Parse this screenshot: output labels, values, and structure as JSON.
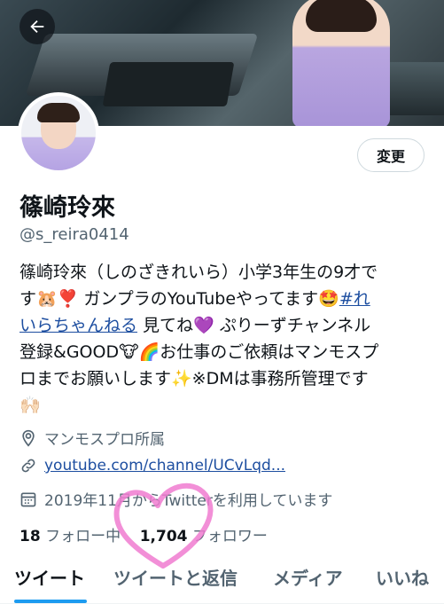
{
  "header": {
    "back_label": "戻る"
  },
  "profile": {
    "edit_button": "変更",
    "name": "篠崎玲來",
    "handle": "@s_reira0414",
    "bio_lines": [
      "篠崎玲來（しのざきれいら）小学3年生の9才で",
      "す🐹❣️ ガンプラのYouTubeやってます🤩",
      "いらちゃんねる",
      " 見てね💜 ぷりーずチャンネル",
      "登録&GOOD🐮🌈お仕事のご依頼はマンモスプ",
      "ロまでお願いします✨※DMは事務所管理です",
      "🙌🏻"
    ],
    "bio_hashtag_start": "#れ",
    "location": "マンモスプロ所属",
    "url": "youtube.com/channel/UCvLqd...",
    "joined": "2019年11月からTwitterを利用しています",
    "following_count": "18",
    "following_label": "フォロー中",
    "followers_count": "1,704",
    "followers_label": "フォロワー"
  },
  "tabs": [
    {
      "label": "ツイート",
      "active": true
    },
    {
      "label": "ツイートと返信",
      "active": false
    },
    {
      "label": "メディア",
      "active": false
    },
    {
      "label": "いいね",
      "active": false
    }
  ],
  "colors": {
    "accent": "#1d9bf0",
    "link": "#1d4ea0",
    "secondary_text": "#536471",
    "annotation": "#f07bd0"
  }
}
